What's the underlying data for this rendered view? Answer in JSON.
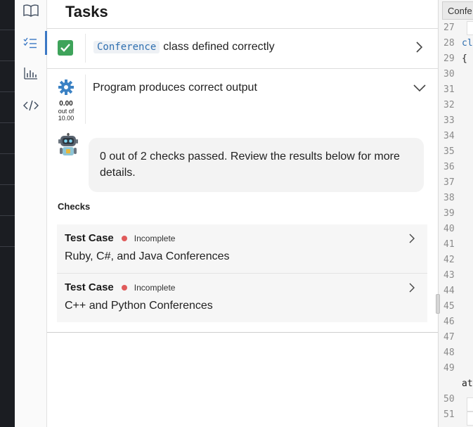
{
  "panel": {
    "title": "Tasks"
  },
  "rail": {
    "items": [
      {
        "icon": "book-icon"
      },
      {
        "icon": "task-list-icon",
        "active": true
      },
      {
        "icon": "bar-chart-icon"
      },
      {
        "icon": "code-icon"
      }
    ]
  },
  "tasks": [
    {
      "status": "passed",
      "code_label": "Conference",
      "label": "class defined correctly",
      "expanded": false
    },
    {
      "status": "pending",
      "label": "Program produces correct output",
      "score_value": "0.00",
      "score_out_of": "out of",
      "score_total": "10.00",
      "expanded": true,
      "message": "0 out of 2 checks passed. Review the results below for more details.",
      "checks_title": "Checks",
      "checks": [
        {
          "name": "Test Case",
          "status": "Incomplete",
          "description": "Ruby, C#, and Java Conferences"
        },
        {
          "name": "Test Case",
          "status": "Incomplete",
          "description": "C++ and Python Conferences"
        }
      ]
    }
  ],
  "editor": {
    "tab_label": "Confe",
    "line_numbers": [
      "27",
      "28",
      "29",
      "30",
      "31",
      "32",
      "33",
      "34",
      "35",
      "36",
      "37",
      "38",
      "39",
      "40",
      "41",
      "42",
      "43",
      "44",
      "45",
      "46",
      "47",
      "48",
      "49",
      "50",
      "51"
    ],
    "code_fragments": {
      "line28": "cl",
      "line29": "{",
      "wrap": "at"
    }
  },
  "colors": {
    "accent": "#3b78c4",
    "success": "#3ea35a",
    "incomplete_dot": "#e05b5b",
    "gear": "#3b82c4"
  }
}
